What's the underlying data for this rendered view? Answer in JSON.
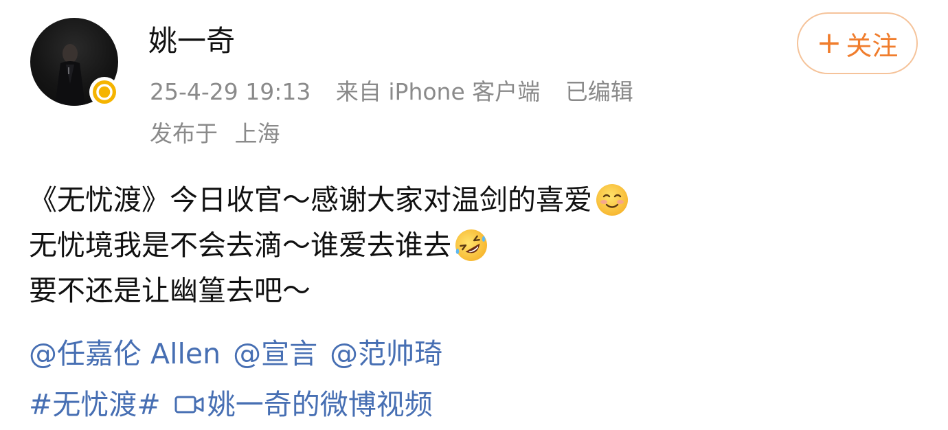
{
  "post": {
    "author": {
      "name": "姚一奇",
      "verified_icon": "verified-badge-icon",
      "badge_color": "#f5b400"
    },
    "meta": {
      "timestamp": "25-4-29 19:13",
      "source": "来自 iPhone 客户端",
      "edited": "已编辑"
    },
    "location": {
      "prefix": "发布于",
      "city": "上海"
    },
    "follow_button": {
      "plus": "+",
      "label": "关注",
      "color": "#f07d2d"
    },
    "text_lines": [
      "《无忧渡》今日收官～感谢大家对温剑的喜爱",
      "无忧境我是不会去滴～谁爱去谁去",
      "要不还是让幽篁去吧～"
    ],
    "emojis": [
      "smiling-face-emoji",
      "rolling-laughing-emoji"
    ],
    "mentions": [
      "@任嘉伦 Allen",
      "@宣言",
      "@范帅琦"
    ],
    "hashtag": "#无忧渡#",
    "video_link": {
      "icon": "video-camera-icon",
      "label": "姚一奇的微博视频"
    },
    "link_color": "#476fb3",
    "meta_color": "#8a8a8a"
  }
}
